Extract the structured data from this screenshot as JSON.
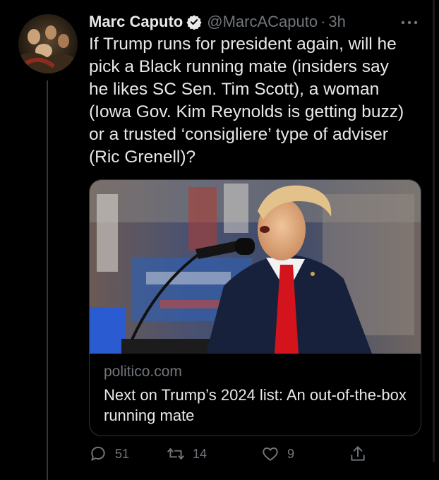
{
  "author": {
    "name": "Marc Caputo",
    "handle": "@MarcACaputo",
    "separator": "·",
    "time": "3h"
  },
  "tweet": {
    "text": "If Trump runs for president again, will he\npick a Black running mate (insiders say\nhe likes SC Sen. Tim Scott), a woman\n(Iowa Gov. Kim Reynolds is getting buzz)\nor a trusted ‘consigliere’ type of adviser\n(Ric Grenell)?"
  },
  "card": {
    "domain": "politico.com",
    "title": "Next on Trump’s 2024 list: An out-of-the-box running mate"
  },
  "actions": {
    "replies": "51",
    "retweets": "14",
    "likes": "9"
  },
  "icons": {
    "more": "more-options-icon",
    "verified": "verified-badge-icon",
    "reply": "reply-icon",
    "retweet": "retweet-icon",
    "like": "heart-icon",
    "share": "share-icon"
  },
  "colors": {
    "background": "#000000",
    "text": "#e7e9ea",
    "muted": "#71767b",
    "border": "#2f3336"
  }
}
